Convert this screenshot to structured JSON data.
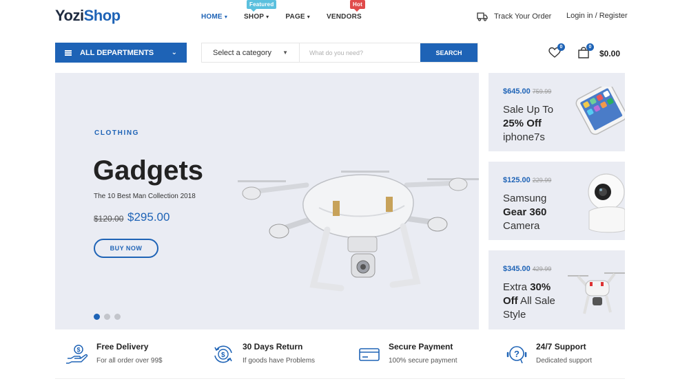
{
  "logo": {
    "part1": "Yozi",
    "part2": "Shop"
  },
  "nav": {
    "items": [
      {
        "label": "HOME",
        "badge": ""
      },
      {
        "label": "SHOP",
        "badge": "Featured"
      },
      {
        "label": "PAGE",
        "badge": ""
      },
      {
        "label": "VENDORS",
        "badge": "Hot"
      }
    ]
  },
  "header": {
    "track_label": "Track Your Order",
    "login_label": "Login in / Register",
    "wishlist_count": "0",
    "cart_count": "0",
    "cart_total": "$0.00"
  },
  "departments": {
    "label": "ALL DEPARTMENTS"
  },
  "search": {
    "category_label": "Select a category",
    "placeholder": "What do you need?",
    "button_label": "SEARCH"
  },
  "hero": {
    "subtitle": "CLOTHING",
    "title": "Gadgets",
    "description": "The 10 Best Man Collection 2018",
    "old_price": "$120.00",
    "new_price": "$295.00",
    "button_label": "BUY NOW",
    "slides": 3,
    "active_slide": 1
  },
  "side_cards": [
    {
      "price": "$645.00",
      "old_price": "759.99",
      "line1": "Sale Up To",
      "line2_bold": "25% Off",
      "line3": "iphone7s"
    },
    {
      "price": "$125.00",
      "old_price": "229.99",
      "line1": "Samsung",
      "line2_bold": "Gear 360",
      "line3": "Camera"
    },
    {
      "price": "$345.00",
      "old_price": "429.99",
      "line1_a": "Extra",
      "line1_bold": "30%",
      "line2_bold": "Off",
      "line2_rest": "All Sale",
      "line3": "Style"
    }
  ],
  "features": [
    {
      "title": "Free Delivery",
      "desc": "For all order over 99$",
      "icon": "delivery-hand-dollar-icon"
    },
    {
      "title": "30 Days Return",
      "desc": "If goods have Problems",
      "icon": "return-dollar-icon"
    },
    {
      "title": "Secure Payment",
      "desc": "100% secure payment",
      "icon": "credit-card-icon"
    },
    {
      "title": "24/7 Support",
      "desc": "Dedicated support",
      "icon": "support-question-icon"
    }
  ],
  "colors": {
    "accent": "#1e63b6",
    "panel_bg": "#eaecf3",
    "featured": "#5bc0de",
    "hot": "#e04b4b"
  }
}
